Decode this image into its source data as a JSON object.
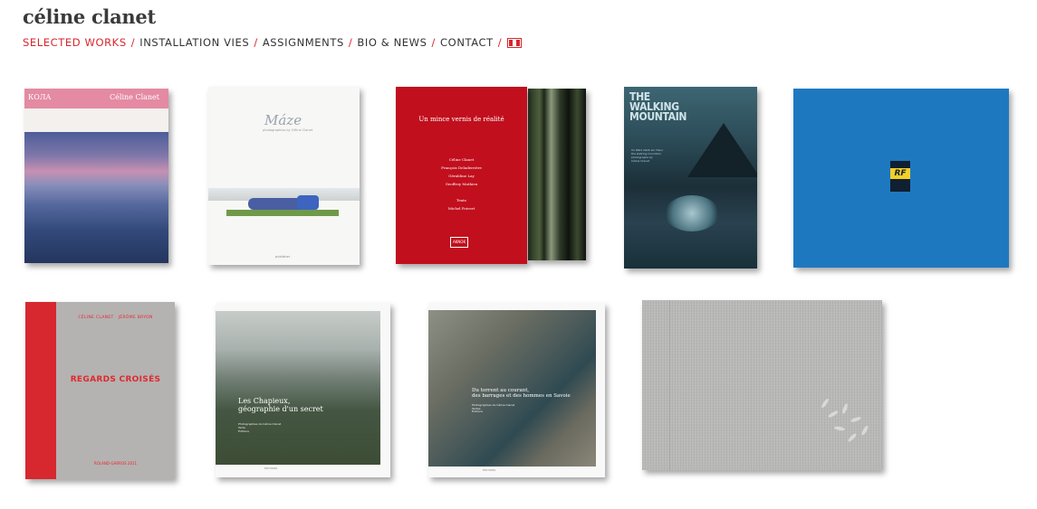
{
  "site": {
    "title": "céline clanet"
  },
  "nav": {
    "items": [
      {
        "label": "SELECTED WORKS",
        "active": true
      },
      {
        "label": "INSTALLATION VIES",
        "active": false
      },
      {
        "label": "ASSIGNMENTS",
        "active": false
      },
      {
        "label": "BIO & NEWS",
        "active": false
      },
      {
        "label": "CONTACT",
        "active": false
      }
    ],
    "separator": "/",
    "language_icon": "french-flag-icon"
  },
  "colors": {
    "accent": "#d8262e",
    "text": "#333333"
  },
  "books": [
    {
      "id": "kola",
      "cover_left": "КОЛА",
      "cover_right": "Céline Clanet"
    },
    {
      "id": "maze",
      "title": "Máze",
      "subtitle": "photographies by Céline Clanet",
      "footer": "publisher"
    },
    {
      "id": "mince-vernis",
      "title": "Un mince vernis de réalité",
      "names": "Céline Clanet\nFrançois Deladerrière\nGéraldine Lay\nGeoffroy Mathieu\n\nTexte\nMichel Poivert",
      "logo": "AKNOK"
    },
    {
      "id": "walking-mountain",
      "title": "THE\nWALKING\nMOUNTAIN",
      "text": "Im Wald steht ein Haus\nthe walking mountain\nphotographs by\nCéline Clanet"
    },
    {
      "id": "rf",
      "badge": "RF"
    },
    {
      "id": "regards-croises",
      "authors": "CÉLINE CLANET · JÉRÔME BRYON",
      "title": "REGARDS CROISÉS",
      "footer": "ROLAND-GARROS 2011"
    },
    {
      "id": "les-chapieux",
      "title": "Les Chapieux,\ngéographie d'un secret",
      "small": "Photographies de Céline Clanet\nTexte\nÉditions",
      "footer": "ÉDITIONS"
    },
    {
      "id": "du-torrent",
      "title": "Du torrent au courant,\ndes barrages et des hommes en Savoie",
      "small": "Photographies de Céline Clanet\nTextes\nÉditions",
      "footer": "ÉDITIONS"
    },
    {
      "id": "linen-book"
    }
  ]
}
